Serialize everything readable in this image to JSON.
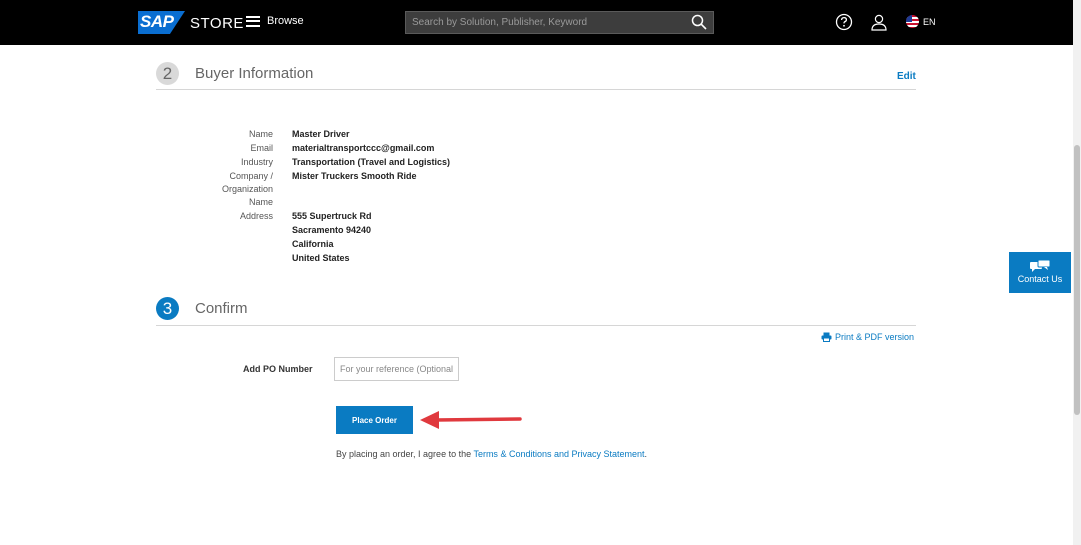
{
  "header": {
    "logo_text": "SAP",
    "store_label": "STORE",
    "browse_label": "Browse",
    "search_placeholder": "Search by Solution, Publisher, Keyword",
    "language": "EN"
  },
  "buyer_section": {
    "step_number": "2",
    "title": "Buyer Information",
    "edit_label": "Edit",
    "fields": {
      "name_label": "Name",
      "name_value": "Master Driver",
      "email_label": "Email",
      "email_value": "materialtransportccc@gmail.com",
      "industry_label": "Industry",
      "industry_value": "Transportation (Travel and Logistics)",
      "company_label": "Company / Organization Name",
      "company_value": "Mister Truckers Smooth Ride",
      "address_label": "Address",
      "address_lines": [
        "555 Supertruck Rd",
        "Sacramento 94240",
        "California",
        "United States"
      ]
    }
  },
  "confirm_section": {
    "step_number": "3",
    "title": "Confirm",
    "print_label": "Print & PDF version",
    "po_label": "Add PO Number",
    "po_placeholder": "For your reference (Optional)",
    "po_value": "",
    "place_order_label": "Place Order",
    "agree_prefix": "By placing an order, I agree to the ",
    "agree_link": "Terms & Conditions and Privacy Statement",
    "agree_suffix": "."
  },
  "contact_us": {
    "label": "Contact Us"
  },
  "colors": {
    "accent": "#0a7bc2",
    "header_bg": "#000000",
    "arrow": "#e0393e"
  },
  "icons": [
    "hamburger-icon",
    "search-icon",
    "help-icon",
    "user-icon",
    "us-flag-icon",
    "printer-icon",
    "chat-bubbles-icon",
    "red-arrow-annotation"
  ]
}
